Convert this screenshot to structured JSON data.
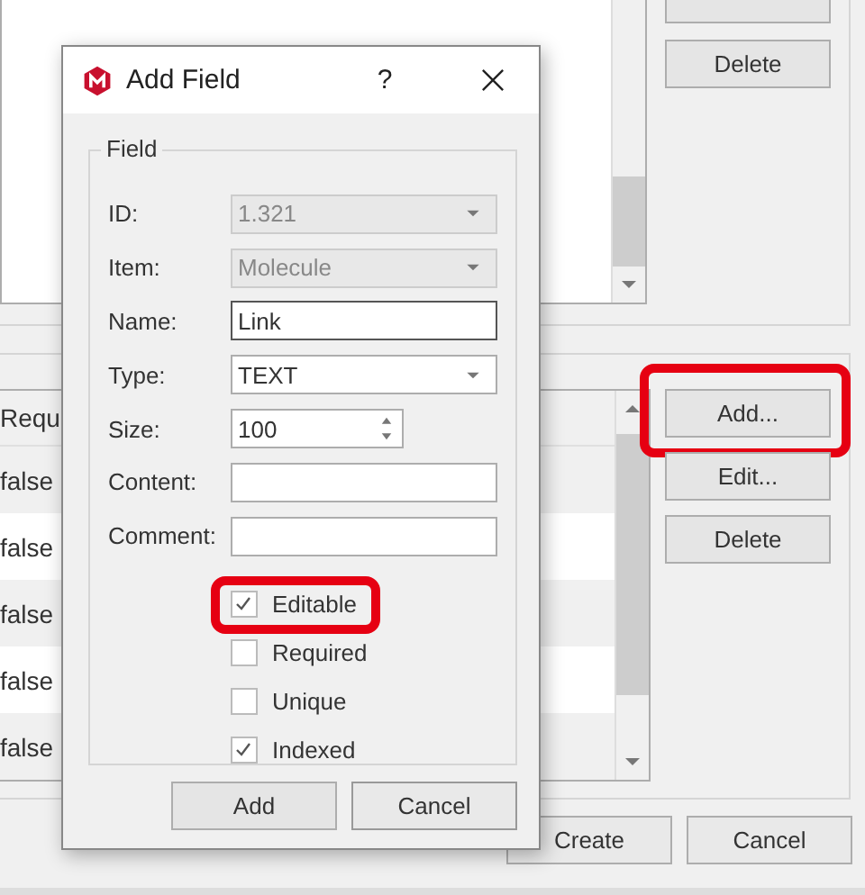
{
  "background": {
    "upper_buttons": [
      {
        "label": "Delete"
      }
    ],
    "table": {
      "columns": [
        "Requ"
      ],
      "rows": [
        {
          "cells": [
            "false"
          ]
        },
        {
          "cells": [
            "false"
          ]
        },
        {
          "cells": [
            "false"
          ]
        },
        {
          "cells": [
            "false"
          ]
        },
        {
          "cells": [
            "false"
          ]
        }
      ]
    },
    "lower_buttons": [
      {
        "label": "Add...",
        "highlighted": true
      },
      {
        "label": "Edit...",
        "highlighted": false
      },
      {
        "label": "Delete",
        "highlighted": false
      }
    ],
    "footer_buttons": [
      {
        "label": "Create"
      },
      {
        "label": "Cancel"
      }
    ]
  },
  "dialog": {
    "title": "Add Field",
    "help": "?",
    "group": "Field",
    "fields": [
      {
        "label": "ID:",
        "kind": "combo",
        "value": "1.321",
        "disabled": true,
        "focused": false
      },
      {
        "label": "Item:",
        "kind": "combo",
        "value": "Molecule",
        "disabled": true,
        "focused": false
      },
      {
        "label": "Name:",
        "kind": "text",
        "value": "Link",
        "disabled": false,
        "focused": true
      },
      {
        "label": "Type:",
        "kind": "combo",
        "value": "TEXT",
        "disabled": false,
        "focused": false
      },
      {
        "label": "Size:",
        "kind": "spin",
        "value": "100",
        "disabled": false,
        "focused": false
      },
      {
        "label": "Content:",
        "kind": "text",
        "disabled": false,
        "focused": false
      },
      {
        "label": "Comment:",
        "kind": "text",
        "disabled": false,
        "focused": false
      }
    ],
    "checkboxes": [
      {
        "label": "Editable",
        "checked": true,
        "highlighted": true
      },
      {
        "label": "Required",
        "checked": false,
        "highlighted": false
      },
      {
        "label": "Unique",
        "checked": false,
        "highlighted": false
      },
      {
        "label": "Indexed",
        "checked": true,
        "highlighted": false
      }
    ],
    "buttons": [
      {
        "label": "Add"
      },
      {
        "label": "Cancel"
      }
    ]
  }
}
